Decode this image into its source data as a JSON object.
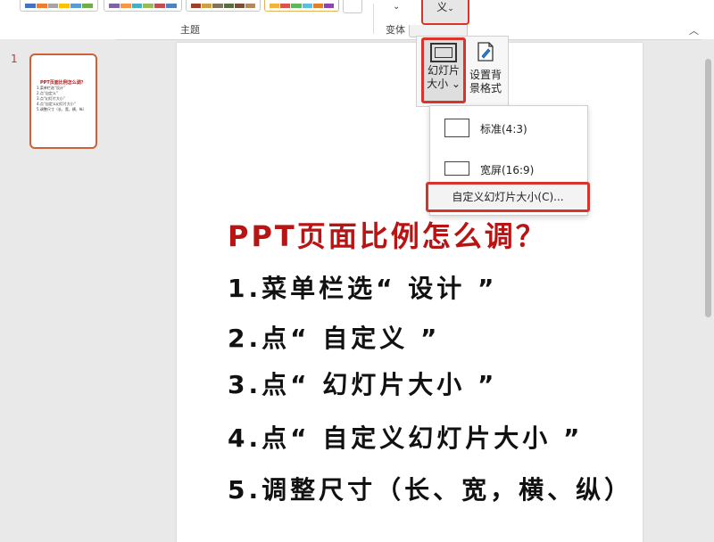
{
  "ribbon": {
    "themes_group_label": "主题",
    "variants_group_label": "变体",
    "custom_button_label": "义",
    "custom_button_chevron": "⌄",
    "variants_chevron": "⌄",
    "collapse_icon": "︿"
  },
  "themes": [
    {
      "colors": [
        "#4472c4",
        "#ed7d31",
        "#a5a5a5",
        "#ffc000",
        "#5b9bd5",
        "#70ad47"
      ]
    },
    {
      "colors": [
        "#8064a2",
        "#f79646",
        "#4bacc6",
        "#9bbb59",
        "#c0504d",
        "#4f81bd"
      ]
    },
    {
      "colors": [
        "#9e3f2c",
        "#c7a247",
        "#83735a",
        "#5a6d3c",
        "#7a4f33",
        "#b58a5a"
      ]
    },
    {
      "colors": [
        "#f2b33d",
        "#d9534f",
        "#5cb85c",
        "#5bc0de",
        "#e67e22",
        "#8e44ad"
      ]
    }
  ],
  "thumbnail": {
    "slide_number": "1",
    "title": "PPT页面比例怎么调？",
    "lines": [
      "1.菜单栏选“设计”",
      "2.点“自定义”",
      "3.点“幻灯片大小”",
      "4.点“自定义幻灯片大小”",
      "5.调整尺寸（长、宽，横、纵）"
    ]
  },
  "slide": {
    "title": "PPT页面比例怎么调？",
    "steps": [
      "1.菜单栏选“ 设计 ”",
      "2.点“ 自定义 ”",
      "3.点“ 幻灯片大小 ”",
      "4.点“ 自定义幻灯片大小 ”",
      "5.调整尺寸（长、宽，横、纵）"
    ]
  },
  "dropdown": {
    "slide_size_label_line1": "幻灯片",
    "slide_size_label_line2": "大小 ⌄",
    "bg_format_label_line1": "设置背",
    "bg_format_label_line2": "景格式",
    "option_standard": "标准(4:3)",
    "option_widescreen": "宽屏(16:9)",
    "option_custom": "自定义幻灯片大小(C)..."
  },
  "colors": {
    "accent_red": "#d9342b",
    "title_red": "#b81414"
  }
}
